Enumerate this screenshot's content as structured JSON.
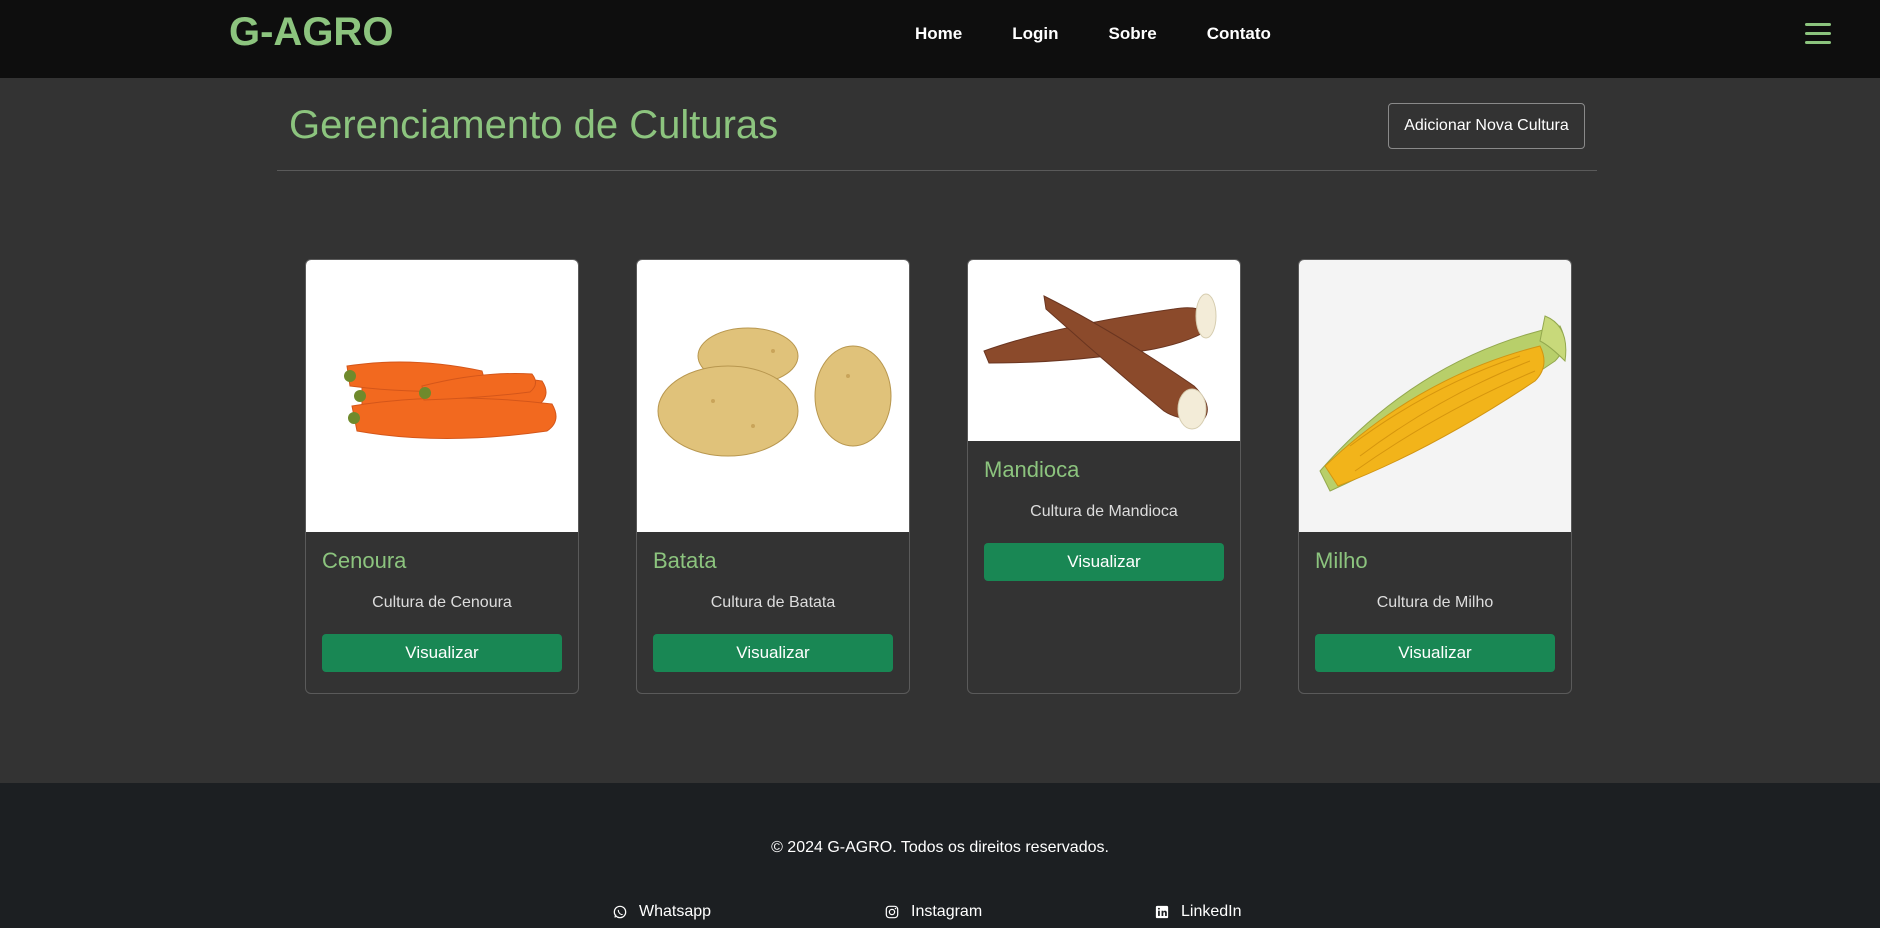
{
  "nav": {
    "brand": "G-AGRO",
    "links": [
      "Home",
      "Login",
      "Sobre",
      "Contato"
    ]
  },
  "main": {
    "title": "Gerenciamento de Culturas",
    "add_button": "Adicionar Nova Cultura",
    "cards": [
      {
        "title": "Cenoura",
        "text": "Cultura de Cenoura",
        "button": "Visualizar",
        "image": "carrots"
      },
      {
        "title": "Batata",
        "text": "Cultura de Batata",
        "button": "Visualizar",
        "image": "potatoes"
      },
      {
        "title": "Mandioca",
        "text": "Cultura de Mandioca",
        "button": "Visualizar",
        "image": "cassava"
      },
      {
        "title": "Milho",
        "text": "Cultura de Milho",
        "button": "Visualizar",
        "image": "corn"
      }
    ]
  },
  "footer": {
    "copyright": "© 2024 G-AGRO. Todos os direitos reservados.",
    "social": [
      {
        "label": "Whatsapp",
        "icon": "whatsapp-icon"
      },
      {
        "label": "Instagram",
        "icon": "instagram-icon"
      },
      {
        "label": "LinkedIn",
        "icon": "linkedin-icon"
      }
    ]
  },
  "colors": {
    "accent": "#8cc47e",
    "button": "#198754",
    "navbar": "#0e0e0e",
    "background": "#333333",
    "footer": "#1c1f22"
  }
}
